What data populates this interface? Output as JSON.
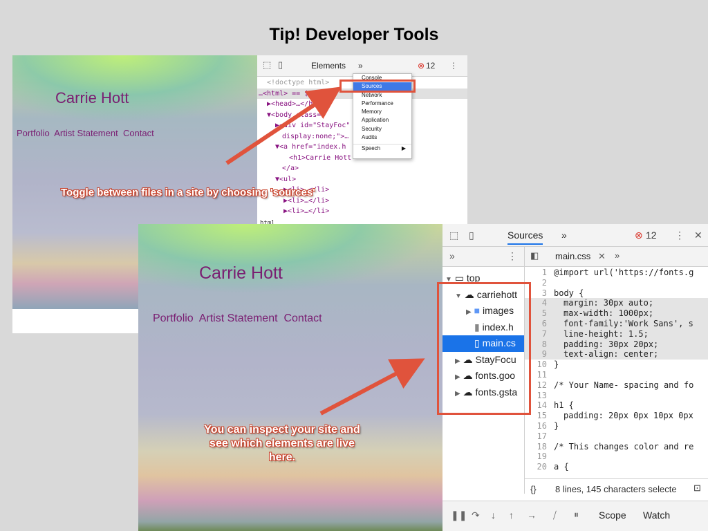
{
  "slide_title": "Tip! Developer Tools",
  "site": {
    "name": "Carrie Hott",
    "nav": [
      "Portfolio",
      "Artist Statement",
      "Contact"
    ]
  },
  "devtools_top": {
    "tab": "Elements",
    "more": "»",
    "error_count": "12",
    "code_lines": [
      "<!doctype html>",
      "…<html> == $0",
      "▶<head>…</head>",
      "▼<body class=\"",
      "▶<div id=\"StayFoc\" style=",
      "display:none;\">…",
      "▼<a href=\"index.h",
      "<h1>Carrie Hott",
      "</a>",
      "▼<ul>",
      "▶<li>…</li>",
      "▶<li>…</li>",
      "▶<li>…</li>"
    ],
    "menu": [
      "Console",
      "Sources",
      "Network",
      "Performance",
      "Memory",
      "Application",
      "Security",
      "Audits",
      "Speech"
    ],
    "bottom_label": "html"
  },
  "devtools_bottom": {
    "tab": "Sources",
    "more": "»",
    "error_count": "12",
    "file_tab": "main.css",
    "tree": [
      "top",
      "carriehott",
      "images",
      "index.h",
      "main.cs",
      "StayFocu",
      "fonts.goo",
      "fonts.gsta"
    ],
    "code": [
      "@import url('https://fonts.g",
      "",
      "body {",
      "margin: 30px auto;",
      "max-width: 1000px;",
      "font-family:'Work Sans', s",
      "line-height: 1.5;",
      "padding: 30px 20px;",
      "text-align: center;",
      "}",
      "",
      "",
      "/* Your Name- spacing and fo",
      "",
      "h1 {",
      "padding: 20px 0px 10px 0px",
      "}",
      "",
      "/* This changes color and re",
      "",
      "a {"
    ],
    "status": "8 lines, 145 characters selecte",
    "bottom_tabs": [
      "Scope",
      "Watch"
    ]
  },
  "callouts": {
    "toggle": "Toggle between files in a site by choosing 'sources'",
    "inspect": "You can inspect your site and see which elements are live here."
  }
}
